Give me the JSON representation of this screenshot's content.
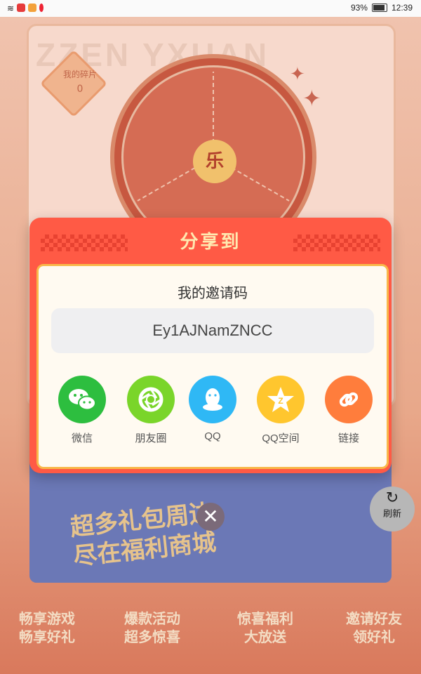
{
  "status_bar": {
    "battery": "93%",
    "time": "12:39"
  },
  "background": {
    "fragment_label": "我的碎片",
    "fragment_count": "0",
    "wheel_center": "乐",
    "promo_title_line1": "超多礼包周边",
    "promo_title_line2": "尽在福利商城",
    "refresh_label": "刷新",
    "nav": [
      {
        "line1": "畅享游戏",
        "line2": "畅享好礼"
      },
      {
        "line1": "爆款活动",
        "line2": "超多惊喜"
      },
      {
        "line1": "惊喜福利",
        "line2": "大放送"
      },
      {
        "line1": "邀请好友",
        "line2": "领好礼"
      }
    ]
  },
  "modal": {
    "title": "分享到",
    "invite_label": "我的邀请码",
    "invite_code": "Ey1AJNamZNCC",
    "share_options": [
      {
        "label": "微信",
        "icon": "wechat-icon",
        "color": "#2dbe3f"
      },
      {
        "label": "朋友圈",
        "icon": "moments-icon",
        "color": "#7ad52a"
      },
      {
        "label": "QQ",
        "icon": "qq-icon",
        "color": "#2fb8f5"
      },
      {
        "label": "QQ空间",
        "icon": "qzone-icon",
        "color": "#ffc62e"
      },
      {
        "label": "链接",
        "icon": "link-icon",
        "color": "#ff7d3c"
      }
    ]
  },
  "close_label": "✕"
}
